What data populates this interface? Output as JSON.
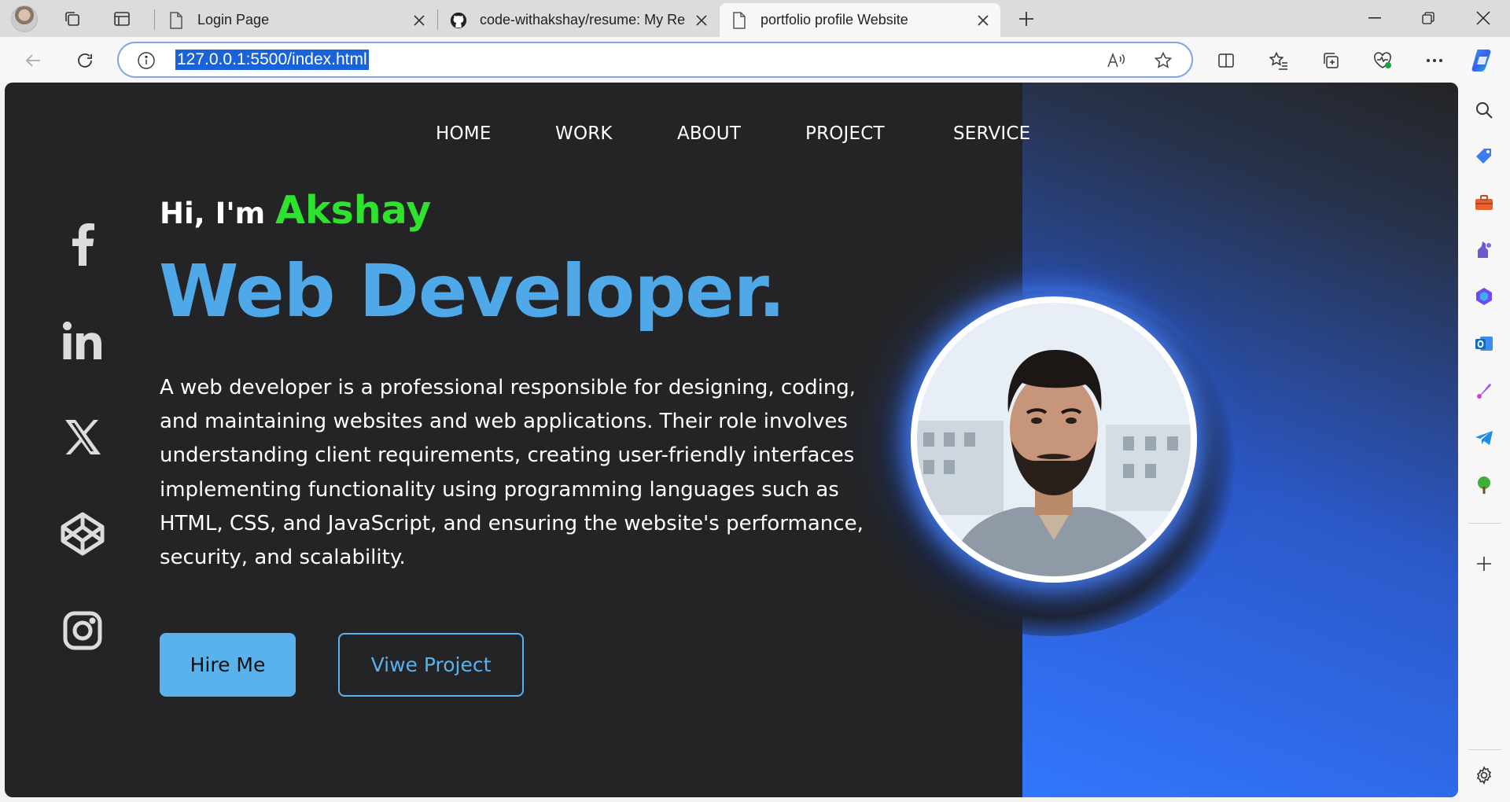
{
  "browser": {
    "tabs": [
      {
        "title": "Login Page",
        "icon": "page-icon"
      },
      {
        "title": "code-withakshay/resume: My Re",
        "icon": "github-icon"
      },
      {
        "title": "portfolio profile Website",
        "icon": "page-icon"
      }
    ],
    "url": "127.0.0.1:5500/index.html",
    "accent": "#1a62d8"
  },
  "site": {
    "nav": [
      "HOME",
      "WORK",
      "ABOUT",
      "PROJECT",
      "SERVICE"
    ],
    "greeting": "Hi, I'm",
    "name": "Akshay",
    "role": "Web Developer.",
    "description_lines": [
      "A web developer is a professional responsible for designing, coding,",
      "and maintaining websites and web applications. Their role involves",
      "understanding client requirements, creating user-friendly interfaces",
      "implementing functionality using programming languages such as",
      "HTML, CSS, and JavaScript, and ensuring the website's performance,",
      "security, and scalability."
    ],
    "buttons": {
      "primary": "Hire Me",
      "secondary": "Viwe Project"
    },
    "social": [
      "facebook-icon",
      "linkedin-icon",
      "x-icon",
      "codepen-icon",
      "instagram-icon"
    ],
    "colors": {
      "background": "#242426",
      "accent_blue": "#4fa8e8",
      "name_green": "#2ee32e",
      "button": "#5ab2ec"
    }
  }
}
